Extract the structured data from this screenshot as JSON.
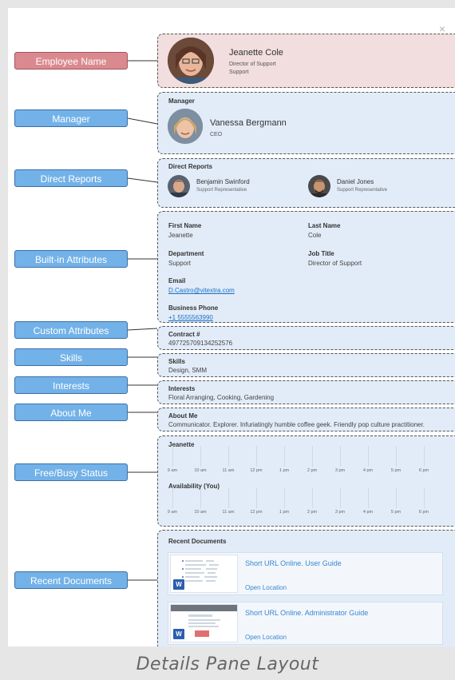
{
  "callouts": {
    "employee_name": "Employee Name",
    "manager": "Manager",
    "direct_reports": "Direct Reports",
    "builtin_attributes": "Built-in Attributes",
    "custom_attributes": "Custom Attributes",
    "skills": "Skills",
    "interests": "Interests",
    "about_me": "About Me",
    "free_busy": "Free/Busy Status",
    "recent_documents": "Recent Documents"
  },
  "employee": {
    "name": "Jeanette Cole",
    "title": "Director of Support",
    "department": "Support"
  },
  "manager": {
    "heading": "Manager",
    "name": "Vanessa Bergmann",
    "title": "CEO"
  },
  "direct_reports": {
    "heading": "Direct Reports",
    "people": [
      {
        "name": "Benjamin Swinford",
        "title": "Support Representative"
      },
      {
        "name": "Daniel Jones",
        "title": "Support Representative"
      }
    ]
  },
  "attributes": {
    "first_name_label": "First Name",
    "first_name": "Jeanette",
    "last_name_label": "Last Name",
    "last_name": "Cole",
    "department_label": "Department",
    "department": "Support",
    "job_title_label": "Job Title",
    "job_title": "Director of Support",
    "email_label": "Email",
    "email": "D.Castro@vitextra.com",
    "phone_label": "Business Phone",
    "phone": "+1 5555563990"
  },
  "custom": {
    "label": "Contract #",
    "value": "497725709134252576"
  },
  "skills": {
    "label": "Skills",
    "value": "Design, SMM"
  },
  "interests": {
    "label": "Interests",
    "value": "Floral Arranging, Cooking, Gardening"
  },
  "about": {
    "label": "About Me",
    "value": "Communicator. Explorer. Infuriatingly humble coffee geek. Friendly pop culture practitioner."
  },
  "freebusy": {
    "person_label": "Jeanette",
    "you_label": "Availability (You)",
    "hours": [
      "9 am",
      "10 am",
      "11 am",
      "12 pm",
      "1 pm",
      "2 pm",
      "3 pm",
      "4 pm",
      "5 pm",
      "6 pm"
    ]
  },
  "documents": {
    "heading": "Recent Documents",
    "items": [
      {
        "title": "Short URL Online. User Guide",
        "location": "Open Location"
      },
      {
        "title": "Short URL Online. Administrator Guide",
        "location": "Open Location"
      }
    ]
  },
  "close_label": "×",
  "caption": "Details Pane Layout",
  "colors": {
    "callout_blue": "#73b2e8",
    "callout_red": "#da8a8e",
    "section_blue": "#e2ecf8",
    "section_pink": "#f2dede",
    "link": "#1a6fc7"
  }
}
